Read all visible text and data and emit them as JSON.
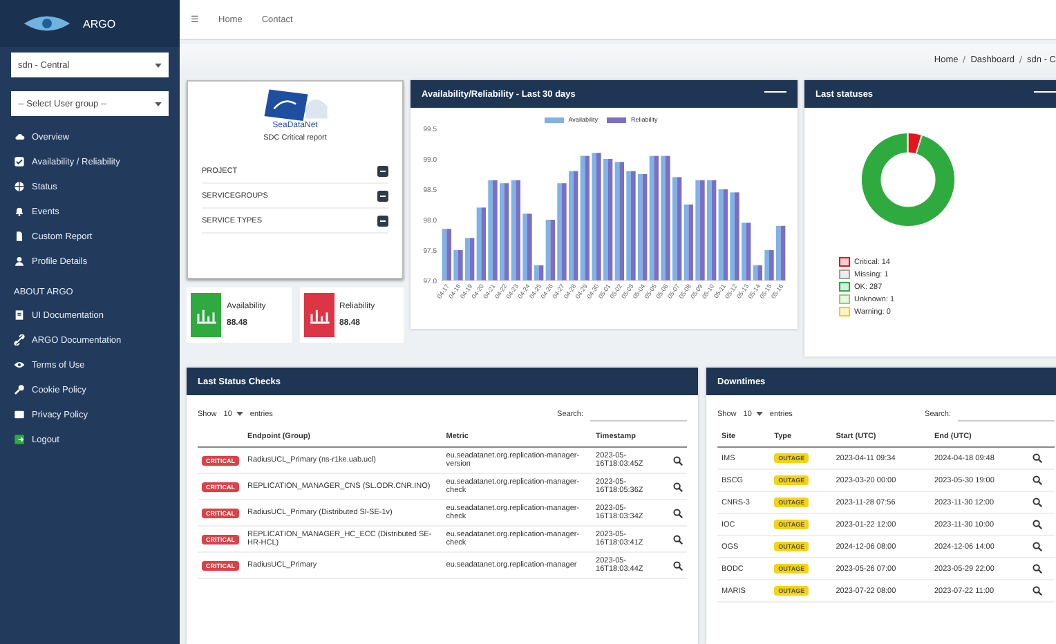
{
  "sidebar": {
    "brand": "ARGO",
    "tenant_select": "sdn - Central",
    "group_select": "-- Select User group --",
    "items": [
      {
        "label": "Overview",
        "selected": false
      },
      {
        "label": "Availability / Reliability",
        "selected": false
      },
      {
        "label": "Status",
        "selected": false
      },
      {
        "label": "Events",
        "selected": false
      },
      {
        "label": "Custom Report",
        "selected": false
      },
      {
        "label": "Profile Details",
        "selected": false
      }
    ],
    "section": "ABOUT ARGO",
    "about_items": [
      {
        "label": "UI Documentation"
      },
      {
        "label": "ARGO Documentation"
      },
      {
        "label": "Terms of Use"
      },
      {
        "label": "Cookie Policy"
      },
      {
        "label": "Privacy Policy"
      },
      {
        "label": "Logout"
      }
    ]
  },
  "topbar": {
    "menu": "☰",
    "links": [
      "Home",
      "Contact"
    ]
  },
  "breadcrumb": [
    "Home",
    "Dashboard",
    "sdn - C"
  ],
  "report_card": {
    "logo_text": "SeaDataNet",
    "subtitle": "SDC Critical report",
    "rows": [
      "PROJECT",
      "SERVICEGROUPS",
      "SERVICE TYPES"
    ]
  },
  "tiles": [
    {
      "label": "Availability",
      "value": "88.48",
      "color": "#2eaa3f"
    },
    {
      "label": "Reliability",
      "value": "88.48",
      "color": "#dc3545"
    }
  ],
  "chart_panel": {
    "title": "Availability/Reliability - Last 30 days",
    "chart_data": {
      "type": "bar",
      "categories": [
        "04-17",
        "04-18",
        "04-19",
        "04-20",
        "04-21",
        "04-22",
        "04-23",
        "04-24",
        "04-25",
        "04-26",
        "04-27",
        "04-28",
        "04-29",
        "04-30",
        "05-01",
        "05-02",
        "05-03",
        "05-04",
        "05-05",
        "05-06",
        "05-07",
        "05-08",
        "05-09",
        "05-10",
        "05-11",
        "05-12",
        "05-13",
        "05-14",
        "05-15",
        "05-16"
      ],
      "series": [
        {
          "name": "Availability",
          "color": "#7fb2e5",
          "values": [
            97.85,
            97.5,
            97.7,
            98.2,
            98.65,
            98.6,
            98.65,
            98.1,
            97.25,
            98.0,
            98.6,
            98.8,
            99.05,
            99.1,
            99.0,
            98.95,
            98.8,
            98.75,
            99.05,
            99.05,
            98.7,
            98.25,
            98.65,
            98.65,
            98.5,
            98.45,
            97.95,
            97.25,
            97.5,
            97.9
          ]
        },
        {
          "name": "Reliability",
          "color": "#7b6fc4",
          "values": [
            97.85,
            97.5,
            97.7,
            98.2,
            98.65,
            98.6,
            98.65,
            98.1,
            97.25,
            98.0,
            98.6,
            98.8,
            99.05,
            99.1,
            99.0,
            98.95,
            98.8,
            98.75,
            99.05,
            99.05,
            98.7,
            98.25,
            98.65,
            98.65,
            98.5,
            98.45,
            97.95,
            97.25,
            97.5,
            97.9
          ]
        }
      ],
      "ylim": [
        97.0,
        99.5
      ],
      "yticks": [
        {
          "value": 97,
          "label": "97.0"
        },
        97.5,
        {
          "value": 98,
          "label": "98.0"
        },
        98.5,
        {
          "value": 99,
          "label": "99.0"
        },
        99.5
      ]
    }
  },
  "status_panel": {
    "title": "Last statuses",
    "legend": [
      {
        "label": "Critical:",
        "count": "14",
        "color": "#e8141b"
      },
      {
        "label": "Missing:",
        "count": "1",
        "color": "#a0a0a0"
      },
      {
        "label": "OK:",
        "count": "287",
        "color": "#2eaa3f"
      },
      {
        "label": "Unknown:",
        "count": "1",
        "color": "#9acd74"
      },
      {
        "label": "Warning:",
        "count": "0",
        "color": "#f0d000"
      }
    ]
  },
  "checks_table": {
    "title": "Last Status Checks",
    "show": "Show",
    "entries_value": "10",
    "entries": "entries",
    "search": "Search:",
    "columns": [
      "",
      "Endpoint (Group)",
      "Metric",
      "Timestamp"
    ],
    "rows": [
      {
        "status": "CRITICAL",
        "endpoint": "RadiusUCL_Primary (ns-r1ke.uab.ucl)",
        "metric": "eu.seadatanet.org.replication-manager-version",
        "timestamp": "2023-05-16T18:03:45Z"
      },
      {
        "status": "CRITICAL",
        "endpoint": "REPLICATION_MANAGER_CNS (SL.ODR.CNR.INO)",
        "metric": "eu.seadatanet.org.replication-manager-check",
        "timestamp": "2023-05-16T18:05:36Z"
      },
      {
        "status": "CRITICAL",
        "endpoint": "RadiusUCL_Primary (Distributed Sl-SE-1v)",
        "metric": "eu.seadatanet.org.replication-manager-check",
        "timestamp": "2023-05-16T18:03:34Z"
      },
      {
        "status": "CRITICAL",
        "endpoint": "REPLICATION_MANAGER_HC_ECC (Distributed SE-HR-HCL)",
        "metric": "eu.seadatanet.org.replication-manager-check",
        "timestamp": "2023-05-16T18:03:41Z"
      },
      {
        "status": "CRITICAL",
        "endpoint": "RadiusUCL_Primary",
        "metric": "eu.seadatanet.org.replication-manager",
        "timestamp": "2023-05-16T18:03:44Z"
      }
    ]
  },
  "downtimes_table": {
    "title": "Downtimes",
    "show": "Show",
    "entries_value": "10",
    "entries": "entries",
    "search": "Search:",
    "columns": [
      "Site",
      "Type",
      "Start (UTC)",
      "End (UTC)"
    ],
    "rows": [
      {
        "site": "IMS",
        "type": "OUTAGE",
        "start": "2023-04-11 09:34",
        "end": "2024-04-18 09:48"
      },
      {
        "site": "BSCG",
        "type": "OUTAGE",
        "start": "2023-03-20 00:00",
        "end": "2023-05-30 19:00"
      },
      {
        "site": "CNRS-3",
        "type": "OUTAGE",
        "start": "2023-11-28 07:56",
        "end": "2023-11-30 12:00"
      },
      {
        "site": "IOC",
        "type": "OUTAGE",
        "start": "2023-01-22 12:00",
        "end": "2023-11-30 10:00"
      },
      {
        "site": "OGS",
        "type": "OUTAGE",
        "start": "2024-12-06 08:00",
        "end": "2024-12-06 14:00"
      },
      {
        "site": "BODC",
        "type": "OUTAGE",
        "start": "2023-05-26 07:00",
        "end": "2023-05-29 22:00"
      },
      {
        "site": "MARIS",
        "type": "OUTAGE",
        "start": "2023-07-22 08:00",
        "end": "2023-07-22 11:00"
      }
    ]
  }
}
